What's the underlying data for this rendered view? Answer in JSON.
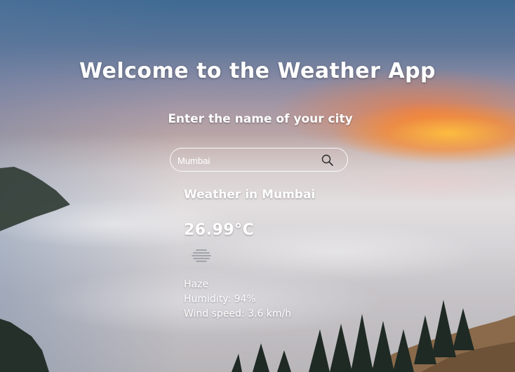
{
  "app": {
    "title": "Welcome to the Weather App",
    "prompt": "Enter the name of your city"
  },
  "search": {
    "value": "Mumbai",
    "placeholder": "",
    "button_icon": "search-icon"
  },
  "weather": {
    "heading": "Weather in Mumbai",
    "temperature": "26.99°C",
    "icon": "haze-icon",
    "description": "Haze",
    "humidity": "Humidity: 94%",
    "wind": "Wind speed: 3.6 km/h"
  },
  "colors": {
    "text": "#ffffff",
    "sun_glow": "#ffb43c",
    "sky_top": "#3f6a93"
  }
}
